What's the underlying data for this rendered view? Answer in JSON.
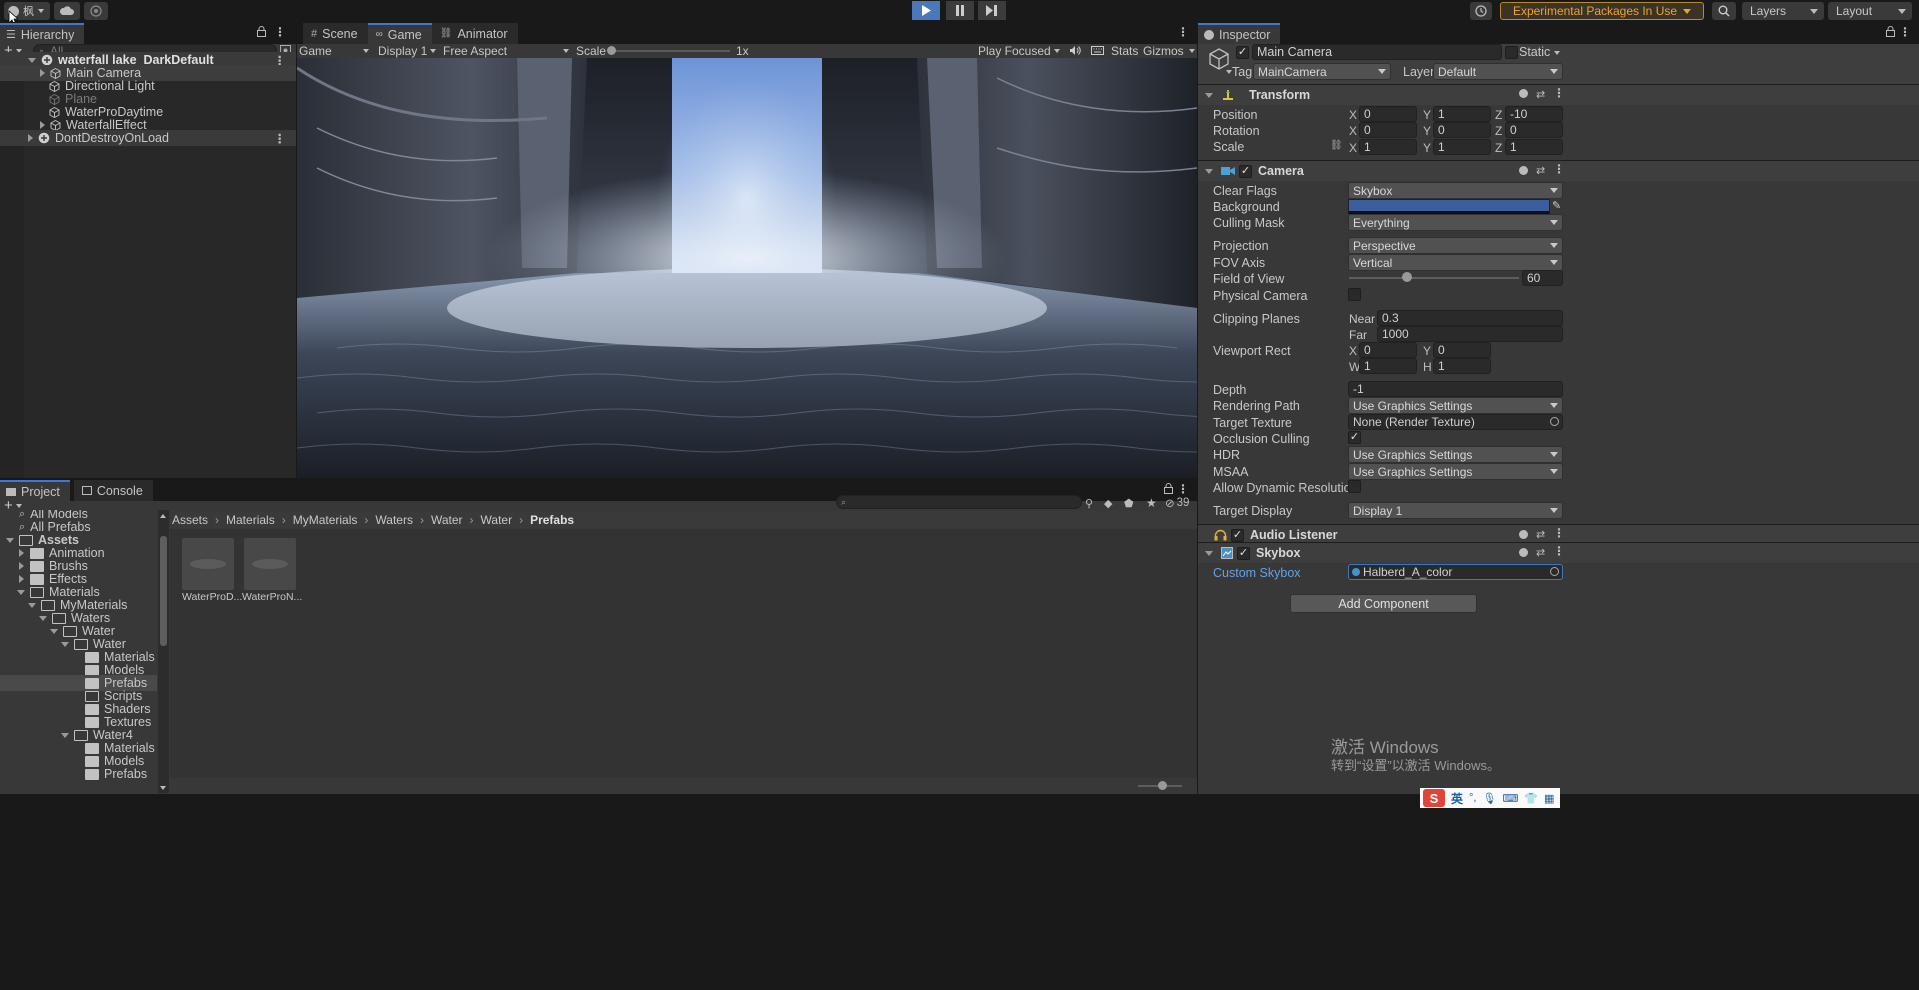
{
  "toolbar": {
    "account_label": "枫",
    "experimental_label": "Experimental Packages In Use",
    "layers_label": "Layers",
    "layout_label": "Layout"
  },
  "hierarchy": {
    "tab": "Hierarchy",
    "search_placeholder": "All",
    "items": [
      {
        "label": "waterfall lake_DarkDefault",
        "bold": true
      },
      {
        "label": "Main Camera"
      },
      {
        "label": "Directional Light"
      },
      {
        "label": "Plane",
        "dim": true
      },
      {
        "label": "WaterProDaytime"
      },
      {
        "label": "WaterfallEffect"
      },
      {
        "label": "DontDestroyOnLoad"
      }
    ]
  },
  "game_view": {
    "tabs": [
      "Scene",
      "Game",
      "Animator"
    ],
    "mode": "Game",
    "display": "Display 1",
    "aspect": "Free Aspect",
    "scale_label": "Scale",
    "scale_value": "1x",
    "play_mode": "Play Focused",
    "stats": "Stats",
    "gizmos": "Gizmos"
  },
  "inspector": {
    "tab": "Inspector",
    "object_name": "Main Camera",
    "static_label": "Static",
    "tag_label": "Tag",
    "tag_value": "MainCamera",
    "layer_label": "Layer",
    "layer_value": "Default",
    "transform": {
      "title": "Transform",
      "position_label": "Position",
      "position": [
        "0",
        "1",
        "-10"
      ],
      "rotation_label": "Rotation",
      "rotation": [
        "0",
        "0",
        "0"
      ],
      "scale_label": "Scale",
      "scale": [
        "1",
        "1",
        "1"
      ]
    },
    "camera": {
      "title": "Camera",
      "clear_flags_label": "Clear Flags",
      "clear_flags": "Skybox",
      "background_label": "Background",
      "background_color": "#3b5f9e",
      "culling_mask_label": "Culling Mask",
      "culling_mask": "Everything",
      "projection_label": "Projection",
      "projection": "Perspective",
      "fov_axis_label": "FOV Axis",
      "fov_axis": "Vertical",
      "fov_label": "Field of View",
      "fov": "60",
      "fov_slider_fraction": 0.34,
      "physical_label": "Physical Camera",
      "clipping_label": "Clipping Planes",
      "near_label": "Near",
      "near": "0.3",
      "far_label": "Far",
      "far": "1000",
      "viewport_label": "Viewport Rect",
      "vx": "0",
      "vy": "0",
      "vw": "1",
      "vh": "1",
      "depth_label": "Depth",
      "depth": "-1",
      "rendering_path_label": "Rendering Path",
      "rendering_path": "Use Graphics Settings",
      "target_texture_label": "Target Texture",
      "target_texture": "None (Render Texture)",
      "occlusion_label": "Occlusion Culling",
      "hdr_label": "HDR",
      "hdr": "Use Graphics Settings",
      "msaa_label": "MSAA",
      "msaa": "Use Graphics Settings",
      "dynres_label": "Allow Dynamic Resolution",
      "target_display_label": "Target Display",
      "target_display": "Display 1"
    },
    "audio_listener": "Audio Listener",
    "skybox": {
      "title": "Skybox",
      "custom_label": "Custom Skybox",
      "custom_value": "Halberd_A_color"
    },
    "add_component": "Add Component"
  },
  "project": {
    "tabs": [
      "Project",
      "Console"
    ],
    "hidden_count": "39",
    "breadcrumb": [
      "Assets",
      "Materials",
      "MyMaterials",
      "Waters",
      "Water",
      "Water",
      "Prefabs"
    ],
    "tree": [
      {
        "label": "All Models",
        "indent": 0,
        "type": "search"
      },
      {
        "label": "All Prefabs",
        "indent": 0,
        "type": "search"
      },
      {
        "label": "Assets",
        "indent": 0,
        "type": "folder-open",
        "bold": true
      },
      {
        "label": "Animation",
        "indent": 1,
        "type": "folder"
      },
      {
        "label": "Brushs",
        "indent": 1,
        "type": "folder"
      },
      {
        "label": "Effects",
        "indent": 1,
        "type": "folder"
      },
      {
        "label": "Materials",
        "indent": 1,
        "type": "folder-open"
      },
      {
        "label": "MyMaterials",
        "indent": 2,
        "type": "folder-open"
      },
      {
        "label": "Waters",
        "indent": 3,
        "type": "folder-open"
      },
      {
        "label": "Water",
        "indent": 4,
        "type": "folder-open"
      },
      {
        "label": "Water",
        "indent": 5,
        "type": "folder-open"
      },
      {
        "label": "Materials",
        "indent": 6,
        "type": "folder"
      },
      {
        "label": "Models",
        "indent": 6,
        "type": "folder"
      },
      {
        "label": "Prefabs",
        "indent": 6,
        "type": "folder",
        "selected": true
      },
      {
        "label": "Scripts",
        "indent": 6,
        "type": "folder-empty"
      },
      {
        "label": "Shaders",
        "indent": 6,
        "type": "folder"
      },
      {
        "label": "Textures",
        "indent": 6,
        "type": "folder"
      },
      {
        "label": "Water4",
        "indent": 5,
        "type": "folder-open"
      },
      {
        "label": "Materials",
        "indent": 6,
        "type": "folder"
      },
      {
        "label": "Models",
        "indent": 6,
        "type": "folder"
      },
      {
        "label": "Prefabs",
        "indent": 6,
        "type": "folder"
      }
    ],
    "assets": [
      "WaterProD...",
      "WaterProN..."
    ]
  },
  "watermark": {
    "line1": "激活 Windows",
    "line2": "转到“设置”以激活 Windows。"
  },
  "taskbar": {
    "ime": "英"
  }
}
